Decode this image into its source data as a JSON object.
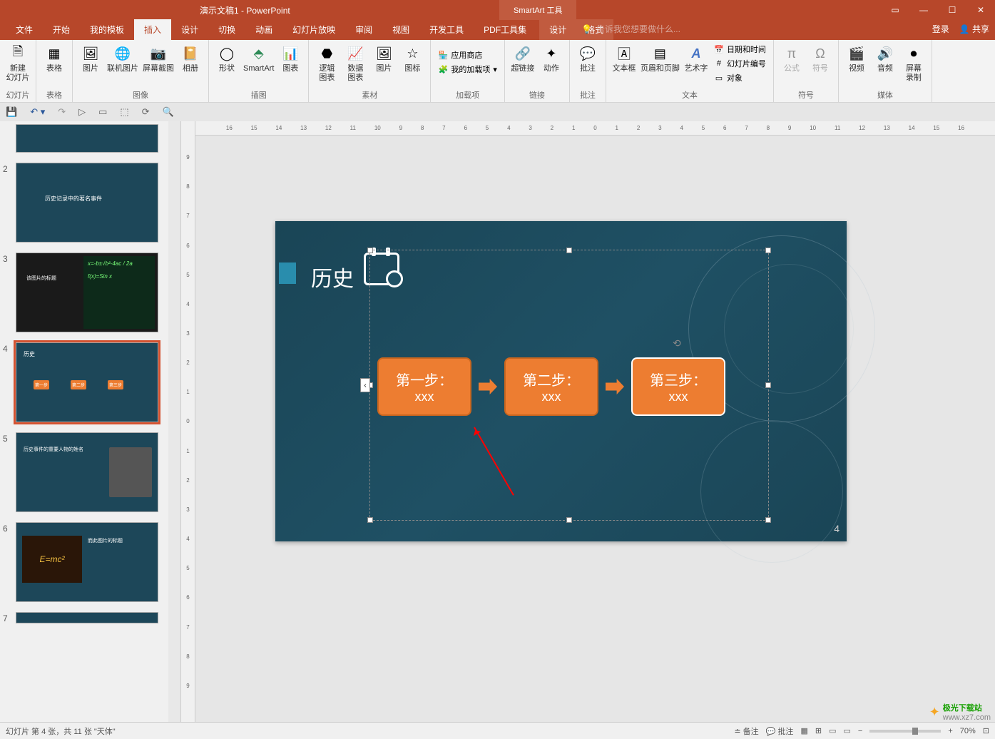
{
  "titlebar": {
    "title": "演示文稿1 - PowerPoint",
    "tools": "SmartArt 工具"
  },
  "menu": {
    "tabs": [
      "文件",
      "开始",
      "我的模板",
      "插入",
      "设计",
      "切换",
      "动画",
      "幻灯片放映",
      "审阅",
      "视图",
      "开发工具",
      "PDF工具集"
    ],
    "tooltabs": [
      "设计",
      "格式"
    ],
    "search": "告诉我您想要做什么...",
    "login": "登录",
    "share": "共享"
  },
  "ribbon": {
    "groups": {
      "slides": {
        "new_slide": "新建\n幻灯片",
        "label": "幻灯片"
      },
      "tables": {
        "table": "表格",
        "label": "表格"
      },
      "images": {
        "picture": "图片",
        "online": "联机图片",
        "screenshot": "屏幕截图",
        "album": "相册",
        "label": "图像"
      },
      "illus": {
        "shapes": "形状",
        "smartart": "SmartArt",
        "chart": "图表",
        "label": "插图"
      },
      "logic": {
        "logic_chart": "逻辑\n图表",
        "data_chart": "数据\n图表",
        "s_pic": "图片",
        "s_icon": "图标",
        "label": "素材"
      },
      "addins": {
        "store": "应用商店",
        "myaddins": "我的加载项",
        "label": "加载项"
      },
      "links": {
        "hyperlink": "超链接",
        "action": "动作",
        "label": "链接"
      },
      "comments": {
        "comment": "批注",
        "label": "批注"
      },
      "text": {
        "textbox": "文本框",
        "header": "页眉和页脚",
        "wordart": "艺术字",
        "datetime": "日期和时间",
        "slidenum": "幻灯片编号",
        "object": "对象",
        "label": "文本"
      },
      "symbols": {
        "equation": "公式",
        "symbol": "符号",
        "label": "符号"
      },
      "media": {
        "video": "视频",
        "audio": "音频",
        "screenrec": "屏幕\n录制",
        "label": "媒体"
      }
    }
  },
  "slide": {
    "title": "历史",
    "step1_a": "第一步：",
    "step1_b": "xxx",
    "step2_a": "第二步：",
    "step2_b": "xxx",
    "step3_a": "第三步：",
    "step3_b": "xxx",
    "num": "4"
  },
  "thumbs": {
    "t2": "历史记录中的著名事件",
    "t3": "该图片的标题",
    "t4": "历史",
    "t4a": "第一步",
    "t4b": "第二步",
    "t4c": "第三步",
    "t5": "历史事件的重要人物的姓名",
    "t6": "而此图片的标题"
  },
  "status": {
    "left": "幻灯片 第 4 张，共 11 张    \"天体\"",
    "notes": "备注",
    "comments": "批注",
    "zoom": "70%"
  },
  "ruler_h": [
    "16",
    "15",
    "14",
    "13",
    "12",
    "11",
    "10",
    "9",
    "8",
    "7",
    "6",
    "5",
    "4",
    "3",
    "2",
    "1",
    "0",
    "1",
    "2",
    "3",
    "4",
    "5",
    "6",
    "7",
    "8",
    "9",
    "10",
    "11",
    "12",
    "13",
    "14",
    "15",
    "16"
  ],
  "ruler_v": [
    "9",
    "8",
    "7",
    "6",
    "5",
    "4",
    "3",
    "2",
    "1",
    "0",
    "1",
    "2",
    "3",
    "4",
    "5",
    "6",
    "7",
    "8",
    "9"
  ],
  "watermark": {
    "site": "极光下载站",
    "url": "www.xz7.com"
  }
}
